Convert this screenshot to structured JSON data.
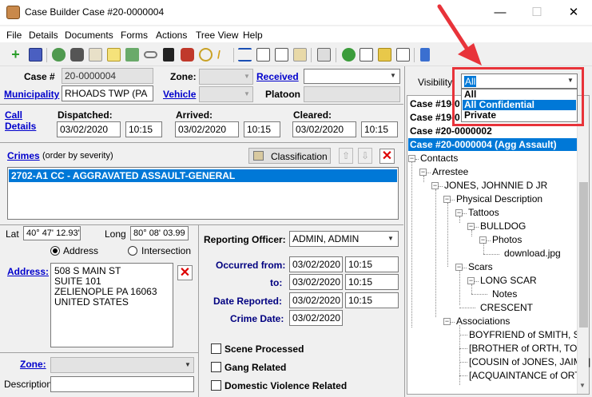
{
  "window": {
    "title": "Case Builder Case #20-0000004",
    "minimize": "—",
    "maximize": "☐",
    "close": "✕"
  },
  "menu": [
    "File",
    "Details",
    "Documents",
    "Forms",
    "Actions",
    "Tree View",
    "Help"
  ],
  "case": {
    "label": "Case #",
    "value": "20-0000004",
    "municipality_label": "Municipality",
    "municipality_value": "RHOADS TWP (PA",
    "zone_label": "Zone:",
    "vehicle_label": "Vehicle",
    "received_label": "Received",
    "platoon_label": "Platoon"
  },
  "call": {
    "label_1": "Call",
    "label_2": "Details",
    "dispatched_label": "Dispatched:",
    "dispatched_date": "03/02/2020",
    "dispatched_time": "10:15",
    "arrived_label": "Arrived:",
    "arrived_date": "03/02/2020",
    "arrived_time": "10:15",
    "cleared_label": "Cleared:",
    "cleared_date": "03/02/2020",
    "cleared_time": "10:15"
  },
  "crimes": {
    "label": "Crimes",
    "note": "(order by severity)",
    "classification_button": "Classification",
    "items": [
      "2702-A1 CC - AGGRAVATED ASSAULT-GENERAL"
    ]
  },
  "location": {
    "lat_label": "Lat",
    "lat_value": "40° 47' 12.93'",
    "long_label": "Long",
    "long_value": "80° 08' 03.99",
    "address_radio": "Address",
    "intersection_radio": "Intersection",
    "address_label": "Address:",
    "address_lines": [
      "508 S MAIN ST",
      "SUITE 101",
      "ZELIENOPLE PA 16063",
      "UNITED STATES"
    ],
    "zone_label": "Zone:",
    "description_label": "Description"
  },
  "reporting": {
    "officer_label": "Reporting Officer:",
    "officer_value": "ADMIN, ADMIN",
    "occurred_from_label": "Occurred from:",
    "occurred_from_date": "03/02/2020",
    "occurred_from_time": "10:15",
    "to_label": "to:",
    "to_date": "03/02/2020",
    "to_time": "10:15",
    "date_reported_label": "Date Reported:",
    "date_reported_date": "03/02/2020",
    "date_reported_time": "10:15",
    "crime_date_label": "Crime Date:",
    "crime_date_value": "03/02/2020"
  },
  "checks": {
    "scene_processed": "Scene Processed",
    "gang_related": "Gang Related",
    "domestic_violence": "Domestic Violence Related"
  },
  "visibility": {
    "label": "Visibility",
    "selected": "All",
    "options": [
      "All",
      "All Confidential",
      "Private"
    ],
    "highlight_color": "#e8333a"
  },
  "tree": {
    "cases": [
      "Case #19-0",
      "Case #19-0",
      "Case #20-0000002",
      "Case #20-0000004 (Agg Assault)"
    ],
    "nodes": [
      "Contacts",
      "Arrestee",
      "JONES, JOHNNIE D JR",
      "Physical Description",
      "Tattoos",
      "BULLDOG",
      "Photos",
      "download.jpg",
      "Scars",
      "LONG SCAR",
      "Notes",
      "CRESCENT",
      "Associations",
      "BOYFRIEND of SMITH, SAI",
      "[BROTHER of ORTH, TOM",
      "[COUSIN of JONES, JAIME]",
      "[ACQUAINTANCE of ORTH"
    ]
  }
}
